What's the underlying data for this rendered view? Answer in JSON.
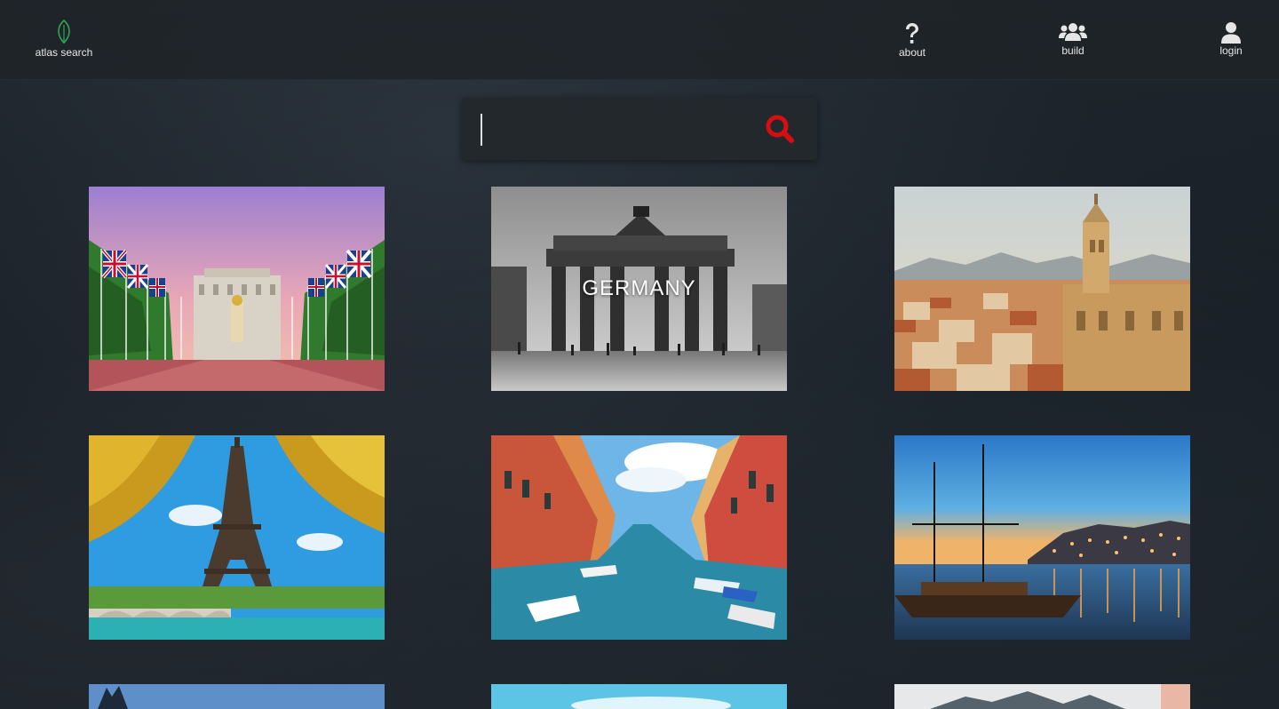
{
  "nav": {
    "brand": {
      "label": "atlas search",
      "icon": "leaf-icon",
      "color": "#2fa84f"
    },
    "items": [
      {
        "label": "about",
        "icon": "question-icon"
      },
      {
        "label": "build",
        "icon": "users-icon"
      },
      {
        "label": "login",
        "icon": "user-icon"
      }
    ]
  },
  "search": {
    "value": "",
    "placeholder": "",
    "icon": "search-icon",
    "icon_color": "#d40f12"
  },
  "cards": [
    {
      "title": "",
      "subject": "london-buckingham-palace"
    },
    {
      "title": "GERMANY",
      "subject": "berlin-brandenburg-gate"
    },
    {
      "title": "",
      "subject": "malaga-cathedral"
    },
    {
      "title": "",
      "subject": "paris-eiffel-tower"
    },
    {
      "title": "",
      "subject": "venice-canal"
    },
    {
      "title": "",
      "subject": "porto-river"
    },
    {
      "title": "",
      "subject": "mountain-landscape"
    },
    {
      "title": "",
      "subject": "tropical-sky"
    },
    {
      "title": "",
      "subject": "rocky-coast"
    }
  ]
}
